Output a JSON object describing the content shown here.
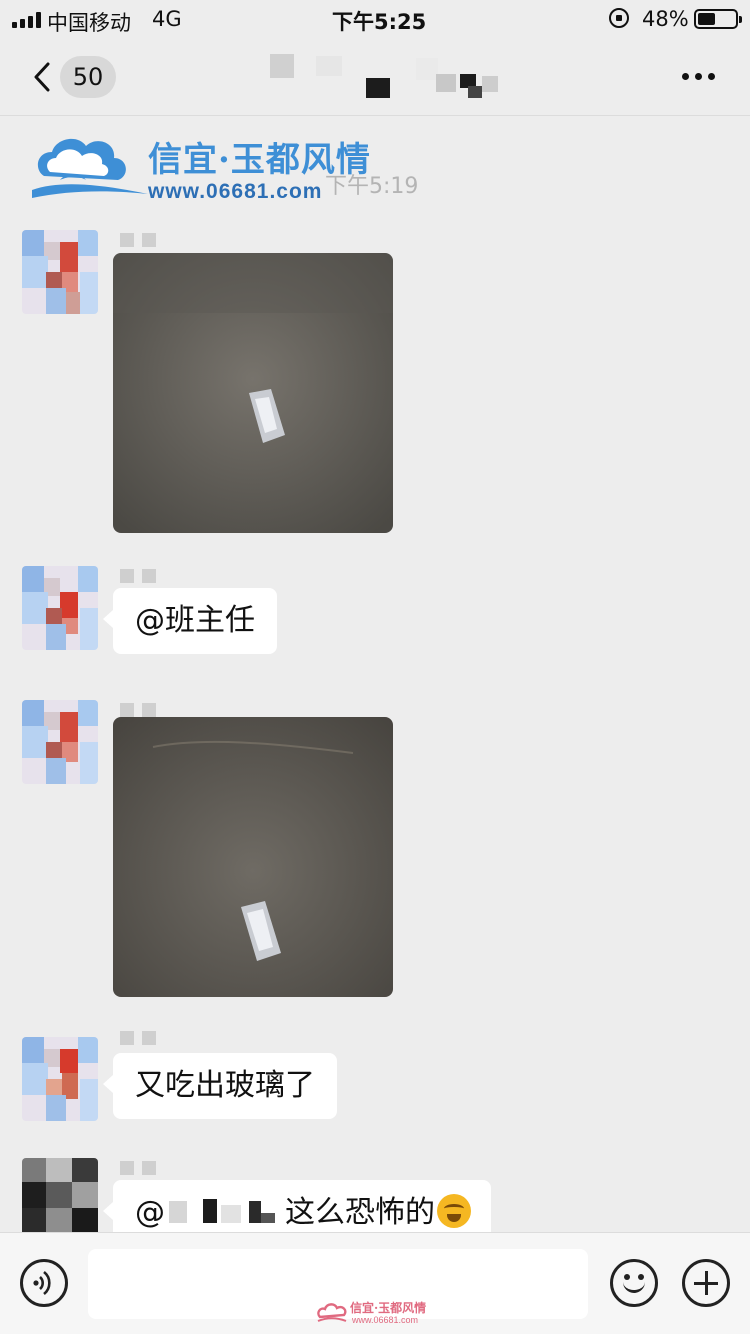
{
  "status_bar": {
    "carrier": "中国移动",
    "network": "4G",
    "time": "下午5:25",
    "battery_percent": "48%",
    "battery_level": 0.48,
    "icons": [
      "signal-icon",
      "rotation-lock-icon",
      "battery-icon"
    ]
  },
  "header": {
    "back_icon": "chevron-left-icon",
    "unread_count": "50",
    "more_icon": "ellipsis-icon"
  },
  "watermark": {
    "title": "信宜·玉都风情",
    "url": "www.06681.com"
  },
  "time_divider": "下午5:19",
  "messages": [
    {
      "type": "image",
      "description_icon": "photo"
    },
    {
      "type": "text",
      "text": "@班主任"
    },
    {
      "type": "image",
      "description_icon": "photo"
    },
    {
      "type": "text",
      "text": "又吃出玻璃了"
    },
    {
      "type": "text",
      "mention_prefix": "@",
      "text": "这么恐怖的",
      "emoji": "crying-laughing-emoji"
    }
  ],
  "input_bar": {
    "voice_icon": "voice-icon",
    "emoji_icon": "smiley-icon",
    "plus_icon": "plus-circle-icon",
    "input_value": "",
    "watermark_title": "信宜·玉都风情",
    "watermark_url": "www.06681.com"
  },
  "colors": {
    "background": "#ededed",
    "bubble": "#ffffff",
    "logo_blue": "#3e8fd6",
    "watermark_pink": "#e06a80"
  }
}
